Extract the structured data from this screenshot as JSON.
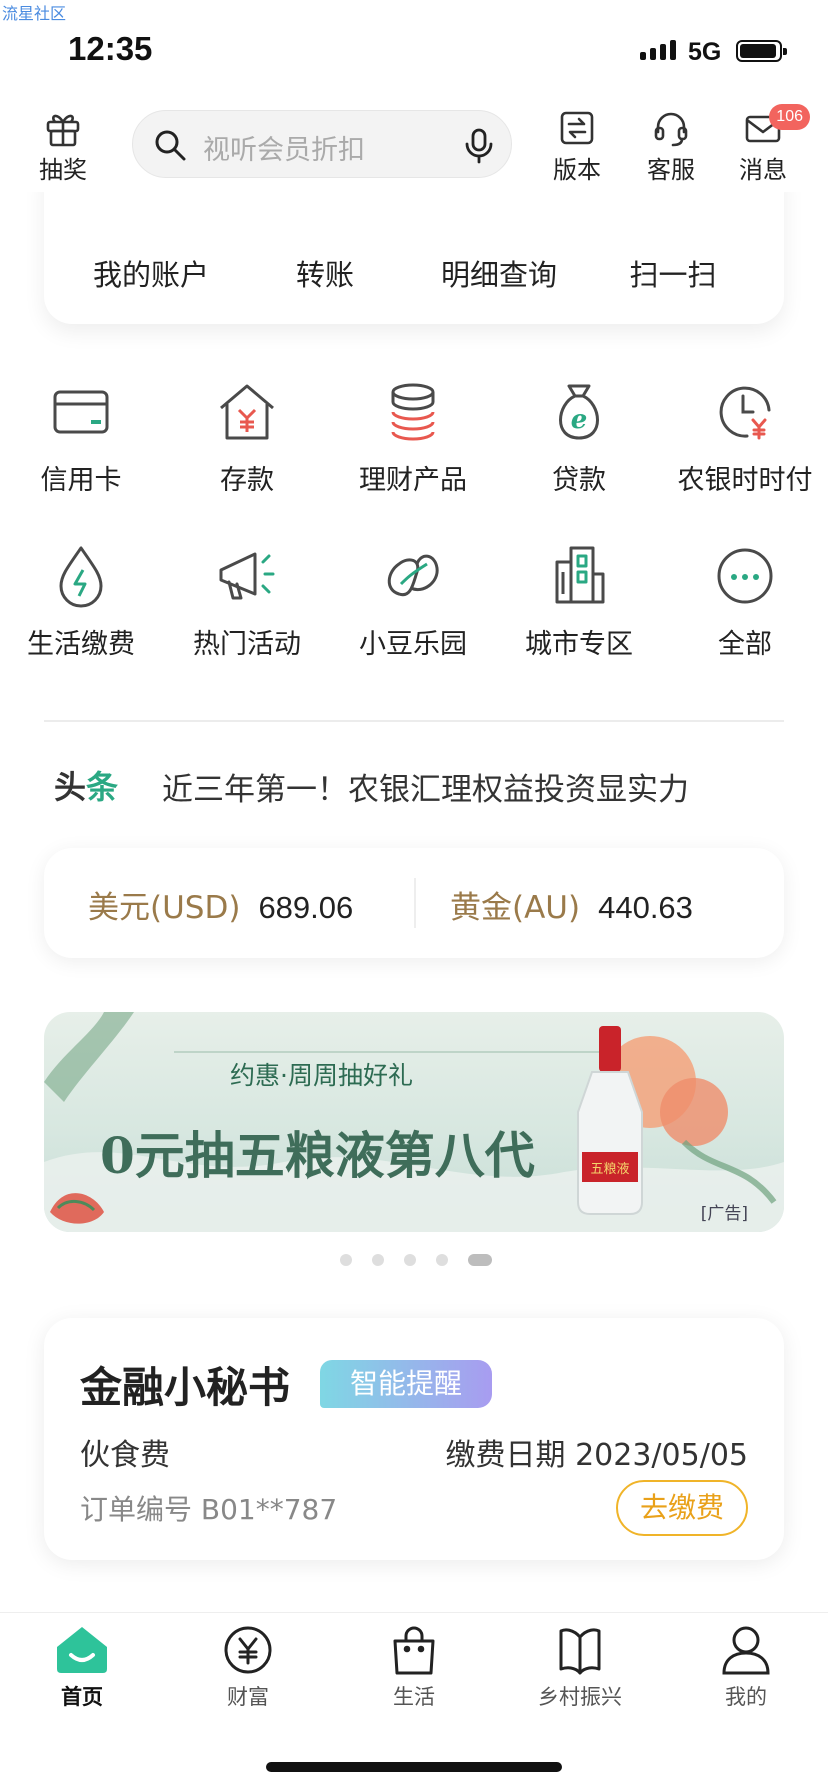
{
  "watermark": "流星社区",
  "status_bar": {
    "time": "12:35",
    "network": "5G"
  },
  "top_bar": {
    "lottery_label": "抽奖",
    "search_placeholder": "视听会员折扣",
    "version_label": "版本",
    "service_label": "客服",
    "message_label": "消息",
    "message_badge": "106"
  },
  "quick_actions": [
    {
      "label": "我的账户"
    },
    {
      "label": "转账"
    },
    {
      "label": "明细查询"
    },
    {
      "label": "扫一扫"
    }
  ],
  "services_row1": [
    {
      "label": "信用卡",
      "icon": "credit-card-icon"
    },
    {
      "label": "存款",
      "icon": "deposit-house-icon"
    },
    {
      "label": "理财产品",
      "icon": "coin-stack-icon"
    },
    {
      "label": "贷款",
      "icon": "money-bag-icon"
    },
    {
      "label": "农银时时付",
      "icon": "clock-yuan-icon"
    }
  ],
  "services_row2": [
    {
      "label": "生活缴费",
      "icon": "utility-drop-icon"
    },
    {
      "label": "热门活动",
      "icon": "megaphone-icon"
    },
    {
      "label": "小豆乐园",
      "icon": "bean-icon"
    },
    {
      "label": "城市专区",
      "icon": "city-buildings-icon"
    },
    {
      "label": "全部",
      "icon": "more-dots-icon"
    }
  ],
  "headline": {
    "tag_part1": "头",
    "tag_part2": "条",
    "text": "近三年第一！农银汇理权益投资显实力"
  },
  "rates": [
    {
      "name": "美元(USD)",
      "value": "689.06"
    },
    {
      "name": "黄金(AU)",
      "value": "440.63"
    }
  ],
  "banner": {
    "subtitle": "约惠·周周抽好礼",
    "title": "0元抽五粮液第八代",
    "ad_label": "[广告]",
    "bottle_label": "五粮液"
  },
  "carousel": {
    "count": 5,
    "active_index": 4
  },
  "secretary": {
    "title": "金融小秘书",
    "tag": "智能提醒",
    "bill_name": "伙食费",
    "due_date": "缴费日期 2023/05/05",
    "order_no": "订单编号 B01**787",
    "pay_button": "去缴费"
  },
  "tab_bar": [
    {
      "label": "首页",
      "icon": "home-icon",
      "active": true
    },
    {
      "label": "财富",
      "icon": "yuan-circle-icon",
      "active": false
    },
    {
      "label": "生活",
      "icon": "shopping-bag-icon",
      "active": false
    },
    {
      "label": "乡村振兴",
      "icon": "book-icon",
      "active": false
    },
    {
      "label": "我的",
      "icon": "person-icon",
      "active": false
    }
  ],
  "colors": {
    "brand_green": "#2aa883",
    "gold_text": "#9a7a4a",
    "pay_orange": "#f0b429",
    "badge_red": "#f2645e"
  }
}
